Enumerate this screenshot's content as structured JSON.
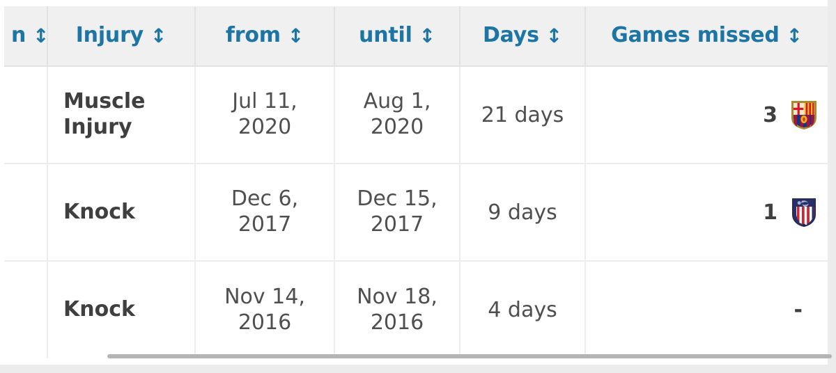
{
  "table": {
    "columns": [
      {
        "key": "season",
        "label": "n",
        "sort_icon": "sort-updown-icon"
      },
      {
        "key": "injury",
        "label": "Injury",
        "sort_icon": "sort-updown-icon"
      },
      {
        "key": "from",
        "label": "from",
        "sort_icon": "sort-updown-icon"
      },
      {
        "key": "until",
        "label": "until",
        "sort_icon": "sort-updown-icon"
      },
      {
        "key": "days",
        "label": "Days",
        "sort_icon": "sort-updown-icon"
      },
      {
        "key": "games_missed",
        "label": "Games missed",
        "sort_icon": "sort-updown-icon"
      }
    ],
    "rows": [
      {
        "season": "",
        "injury": "Muscle Injury",
        "from": "Jul 11, 2020",
        "until": "Aug 1, 2020",
        "days": "21 days",
        "games_missed": "3",
        "club_badge": "fc-barcelona-crest"
      },
      {
        "season": "",
        "injury": "Knock",
        "from": "Dec 6, 2017",
        "until": "Dec 15, 2017",
        "days": "9 days",
        "games_missed": "1",
        "club_badge": "atletico-madrid-crest"
      },
      {
        "season": "",
        "injury": "Knock",
        "from": "Nov 14, 2016",
        "until": "Nov 18, 2016",
        "days": "4 days",
        "games_missed": "-",
        "club_badge": ""
      }
    ]
  },
  "sort_icon_glyph": "↕",
  "colors": {
    "header_text": "#1d75a3",
    "header_background": "#f0f0f0",
    "body_text": "#4a4a4a",
    "border": "#ededed",
    "scrollbar_thumb": "#b4b4b4"
  }
}
